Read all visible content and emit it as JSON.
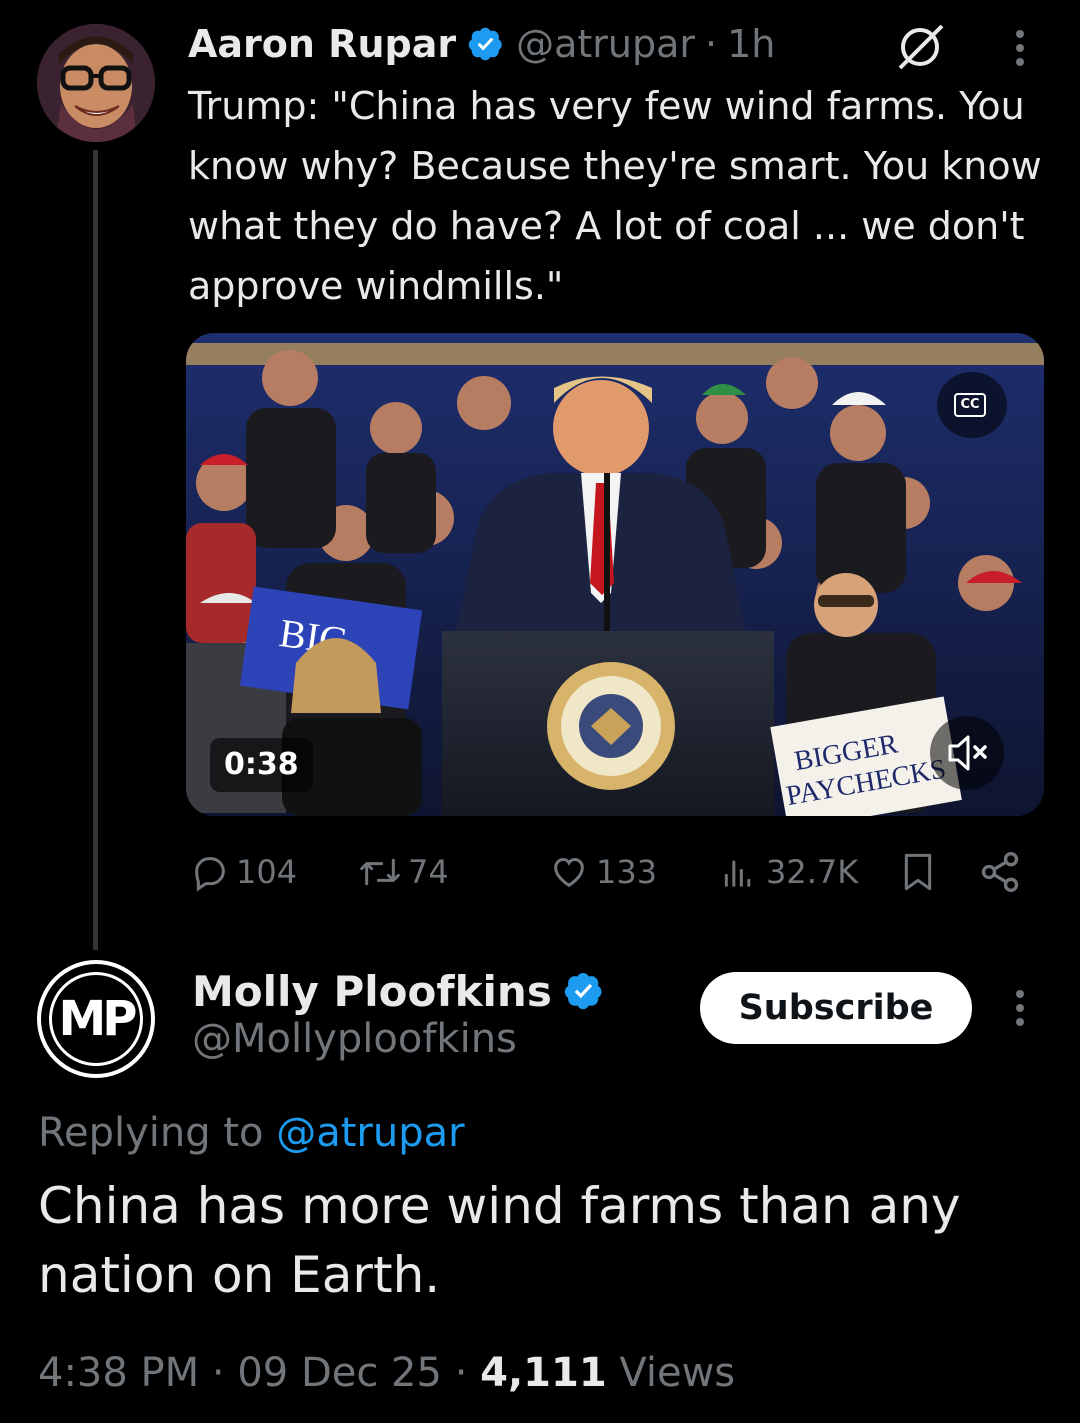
{
  "tweet": {
    "author_name": "Aaron Rupar",
    "handle": "@atrupar",
    "time": "1h",
    "separator": "·",
    "text": "Trump: \"China has very few wind farms. You know why? Because they're smart. You know what they do have? A lot of coal ... we don't approve windmills.\"",
    "video": {
      "duration": "0:38",
      "cc_label": "CC",
      "sign_text": "BIGGER PAYCHECKS",
      "sign_left_text": "BIG"
    },
    "stats": {
      "replies": "104",
      "reposts": "74",
      "likes": "133",
      "views": "32.7K"
    }
  },
  "reply": {
    "avatar_initials": "MP",
    "author_name": "Molly Ploofkins",
    "handle": "@Mollyploofkins",
    "subscribe_label": "Subscribe",
    "replying_prefix": "Replying to",
    "replying_to": "@atrupar",
    "text": "China has more wind farms than any nation on Earth.",
    "time": "4:38 PM",
    "date": "09 Dec 25",
    "views_count": "4,111",
    "views_label": "Views",
    "separator": "·"
  },
  "colors": {
    "background": "#000000",
    "text": "#e7e9ea",
    "secondary": "#71767b",
    "accent": "#1d9bf0"
  }
}
